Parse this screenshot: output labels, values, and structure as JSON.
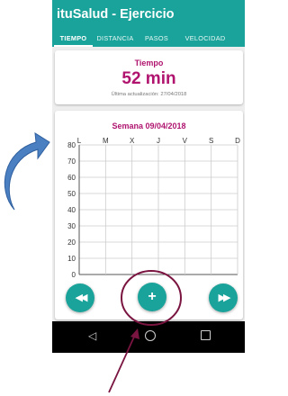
{
  "app": {
    "title": "ituSalud - Ejercicio"
  },
  "tabs": [
    {
      "label": "TIEMPO",
      "active": true
    },
    {
      "label": "DISTANCIA",
      "active": false
    },
    {
      "label": "PASOS",
      "active": false
    },
    {
      "label": "VELOCIDAD",
      "active": false
    }
  ],
  "summary": {
    "label": "Tiempo",
    "value": "52 min",
    "updated": "Última actualización: 27/04/2018"
  },
  "chart_data": {
    "type": "line",
    "title": "Semana 09/04/2018",
    "categories": [
      "L",
      "M",
      "X",
      "J",
      "V",
      "S",
      "D"
    ],
    "series": [],
    "yticks": [
      0,
      10,
      20,
      30,
      40,
      50,
      60,
      70,
      80
    ],
    "ylim": [
      0,
      80
    ],
    "grid": true
  },
  "controls": {
    "rewind_icon": "rewind-icon",
    "add_icon": "plus-icon",
    "forward_icon": "fast-forward-icon",
    "rewind_glyph": "◀◀",
    "add_glyph": "+",
    "forward_glyph": "▶▶"
  },
  "system_nav": {
    "back_glyph": "◁"
  },
  "colors": {
    "primary": "#1aa39a",
    "accent": "#b0146f",
    "annotation_circle": "#7a1440",
    "annotation_arrow_pink": "#7a1440",
    "annotation_arrow_blue": "#4a7fc1"
  }
}
